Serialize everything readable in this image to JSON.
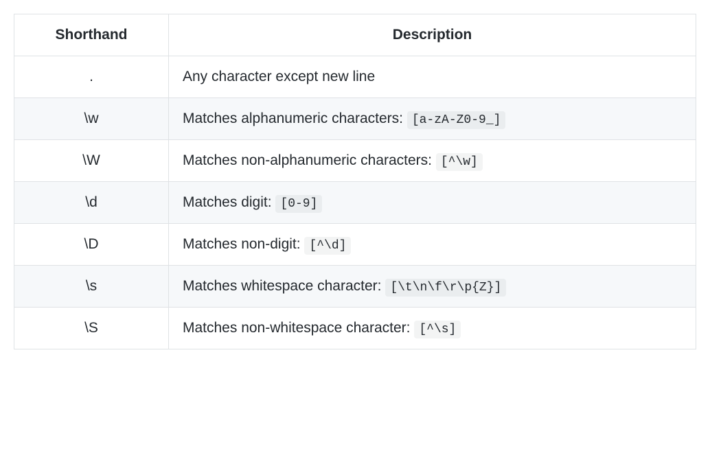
{
  "table": {
    "headers": {
      "shorthand": "Shorthand",
      "description": "Description"
    },
    "rows": [
      {
        "shorthand": ".",
        "description": "Any character except new line",
        "code": ""
      },
      {
        "shorthand": "\\w",
        "description": "Matches alphanumeric characters: ",
        "code": "[a-zA-Z0-9_]"
      },
      {
        "shorthand": "\\W",
        "description": "Matches non-alphanumeric characters: ",
        "code": "[^\\w]"
      },
      {
        "shorthand": "\\d",
        "description": "Matches digit: ",
        "code": "[0-9]"
      },
      {
        "shorthand": "\\D",
        "description": "Matches non-digit: ",
        "code": "[^\\d]"
      },
      {
        "shorthand": "\\s",
        "description": "Matches whitespace character: ",
        "code": "[\\t\\n\\f\\r\\p{Z}]"
      },
      {
        "shorthand": "\\S",
        "description": "Matches non-whitespace character: ",
        "code": "[^\\s]"
      }
    ]
  }
}
